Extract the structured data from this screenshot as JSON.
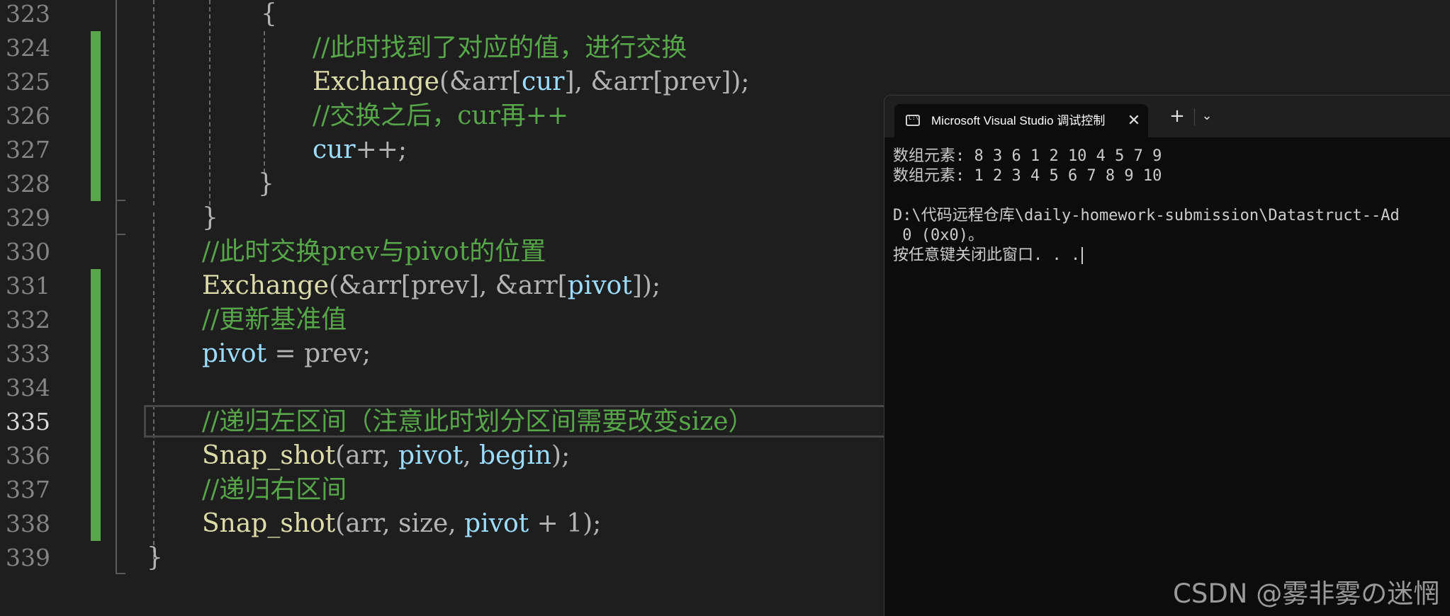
{
  "editor": {
    "lines": [
      {
        "no": "323"
      },
      {
        "no": "324"
      },
      {
        "no": "325"
      },
      {
        "no": "326"
      },
      {
        "no": "327"
      },
      {
        "no": "328"
      },
      {
        "no": "329"
      },
      {
        "no": "330"
      },
      {
        "no": "331"
      },
      {
        "no": "332"
      },
      {
        "no": "333"
      },
      {
        "no": "334"
      },
      {
        "no": "335"
      },
      {
        "no": "336"
      },
      {
        "no": "337"
      },
      {
        "no": "338"
      },
      {
        "no": "339"
      }
    ],
    "code": {
      "l323": "{",
      "l324": "//此时找到了对应的值，进行交换",
      "l325_fn": "Exchange",
      "l325_a": "(&arr[",
      "l325_b": "cur",
      "l325_c": "], &arr[prev]);",
      "l326": "//交换之后，cur再++",
      "l327_a": "cur",
      "l327_b": "++;",
      "l328": "}",
      "l329": "}",
      "l330": "//此时交换prev与pivot的位置",
      "l331_fn": "Exchange",
      "l331_a": "(&arr[prev], &arr[",
      "l331_b": "pivot",
      "l331_c": "]);",
      "l332": "//更新基准值",
      "l333_a": "pivot",
      "l333_b": " = prev;",
      "l335": "//递归左区间（注意此时划分区间需要改变size）",
      "l336_fn": "Snap_shot",
      "l336_a": "(arr, ",
      "l336_b": "pivot",
      "l336_c": ", ",
      "l336_d": "begin",
      "l336_e": ");",
      "l337": "//递归右区间",
      "l338_fn": "Snap_shot",
      "l338_a": "(arr, size, ",
      "l338_b": "pivot",
      "l338_c": " + 1);",
      "l339": "}"
    }
  },
  "console": {
    "tab_title": "Microsoft Visual Studio 调试控制台",
    "tab_close": "✕",
    "new_tab": "+",
    "dropdown": "⌄",
    "output": [
      "数组元素: 8 3 6 1 2 10 4 5 7 9",
      "数组元素: 1 2 3 4 5 6 7 8 9 10",
      "",
      "D:\\代码远程仓库\\daily-homework-submission\\Datastruct--Ad",
      " 0 (0x0)。",
      "按任意键关闭此窗口. . ."
    ]
  },
  "watermark": "CSDN @雾非雾の迷惘"
}
